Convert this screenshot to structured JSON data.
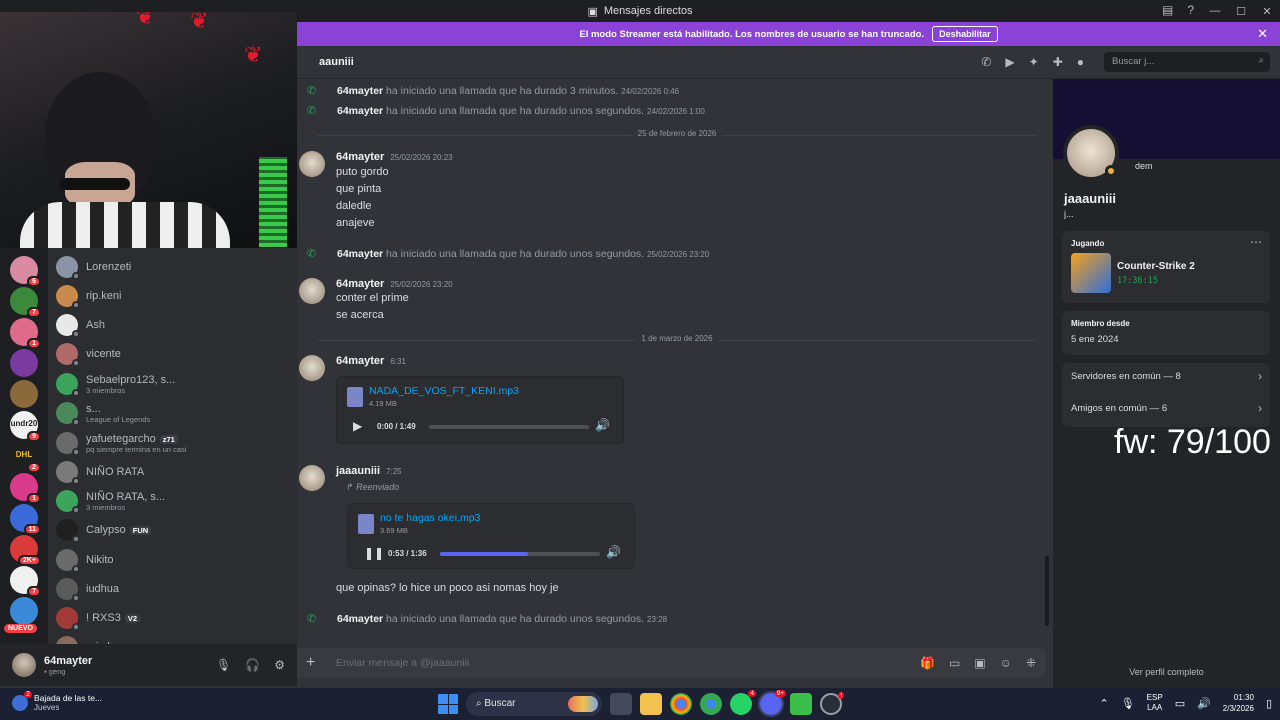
{
  "window": {
    "title": "Mensajes directos"
  },
  "banner": {
    "text": "El modo Streamer está habilitado. Los nombres de usuario se han truncado.",
    "button": "Deshabilitar"
  },
  "chat_header": {
    "name": "aauniii",
    "search_placeholder": "Buscar j..."
  },
  "messages": {
    "call1": {
      "author": "64mayter",
      "text": "ha iniciado una llamada que ha durado 3 minutos.",
      "time": "24/02/2026 0:46"
    },
    "call2": {
      "author": "64mayter",
      "text": "ha iniciado una llamada que ha durado unos segundos.",
      "time": "24/02/2026 1:00"
    },
    "date1": "25 de febrero de 2026",
    "msg1": {
      "author": "64mayter",
      "time": "25/02/2026 20:23",
      "lines": [
        "puto gordo",
        "que pinta",
        "daledle",
        "anajeve"
      ]
    },
    "call3": {
      "author": "64mayter",
      "text": "ha iniciado una llamada que ha durado unos segundos.",
      "time": "25/02/2026 23:20"
    },
    "msg2": {
      "author": "64mayter",
      "time": "25/02/2026 23:20",
      "lines": [
        "conter el prime",
        "se acerca"
      ]
    },
    "date2": "1 de marzo de 2026",
    "msg3": {
      "author": "64mayter",
      "time": "6:31",
      "file": "NADA_DE_VOS_FT_KENI.mp3",
      "size": "4.19 MB",
      "progress": "0:00 / 1:49",
      "fraction": 0.0
    },
    "msg4": {
      "author": "jaaauniii",
      "time": "7:25",
      "forwarded": "Reenviado",
      "file": "no te hagas okei.mp3",
      "size": "3.69 MB",
      "progress": "0:53 / 1:36",
      "fraction": 0.55,
      "text": "que opinas? lo hice un poco asi nomas hoy je"
    },
    "call4": {
      "author": "64mayter",
      "text": "ha iniciado una llamada que ha durado unos segundos.",
      "time": "23:28"
    }
  },
  "composer": {
    "placeholder": "Enviar mensaje a @jaaauniii"
  },
  "dm_list": [
    {
      "name": "Lorenzeti",
      "color": "#8a94a6"
    },
    {
      "name": "rip.keni",
      "color": "#c88a4a"
    },
    {
      "name": "Ash",
      "color": "#e8e8e8"
    },
    {
      "name": "vicente",
      "color": "#b06a6a"
    },
    {
      "name": "Sebaelpro123, s...",
      "sub": "3 miembros",
      "color": "#3ba55c"
    },
    {
      "name": "s...",
      "sub": "League of Legends",
      "color": "#4a8a5a"
    },
    {
      "name": "yafuetegarcho",
      "tag": "z71",
      "sub": "pq siempre termina en un casi",
      "color": "#6a6a6a"
    },
    {
      "name": "NIÑO RATA",
      "color": "#7a7a7a"
    },
    {
      "name": "NIÑO RATA, s...",
      "sub": "3 miembros",
      "color": "#3ba55c"
    },
    {
      "name": "Calypso",
      "tag": "FUN",
      "color": "#202020"
    },
    {
      "name": "Nikito",
      "color": "#6a6a6a"
    },
    {
      "name": "iudhua",
      "color": "#5a5a5a"
    },
    {
      "name": "! RXS3",
      "tag": "V2",
      "color": "#a33a3a"
    },
    {
      "name": "rain.h",
      "color": "#8a6a5a"
    }
  ],
  "servers": [
    {
      "badge": "6",
      "color": "#d98aa0"
    },
    {
      "badge": "7",
      "color": "#3b8a3b"
    },
    {
      "badge": "1",
      "color": "#e06a8a"
    },
    {
      "badge": "",
      "color": "#7a3aa0"
    },
    {
      "badge": "",
      "color": "#8a6a3a"
    },
    {
      "badge": "9",
      "color": "#f0f0f0",
      "label": "undr20"
    },
    {
      "badge": "2",
      "color": "#202020",
      "label": "DHL"
    },
    {
      "badge": "1",
      "color": "#d93a8a"
    },
    {
      "badge": "11",
      "color": "#3a6ad9"
    },
    {
      "badge": "2K+",
      "color": "#d93a3a"
    },
    {
      "badge": "7",
      "color": "#f0f0f0"
    },
    {
      "badge": "",
      "color": "#3a8ad9"
    }
  ],
  "nuevo": "NUEVO",
  "user_panel": {
    "name": "64mayter",
    "status": "geng"
  },
  "profile": {
    "status_note": "dem",
    "name": "jaaauniii",
    "sub": "j...",
    "playing_label": "Jugando",
    "game": "Counter-Strike 2",
    "game_time": "17:36:15",
    "member_since_label": "Miembro desde",
    "member_since": "5 ene 2024",
    "servers_common": "Servidores en común — 8",
    "friends_common": "Amigos en común — 6",
    "overlay_text": "fw: 79/100",
    "view_full": "Ver perfil completo"
  },
  "taskbar": {
    "weather_title": "Bajada de las te...",
    "weather_sub": "Jueves",
    "weather_badge": "2",
    "search": "Buscar",
    "lang1": "ESP",
    "lang2": "LAA",
    "time": "01:30",
    "date": "2/3/2026"
  }
}
